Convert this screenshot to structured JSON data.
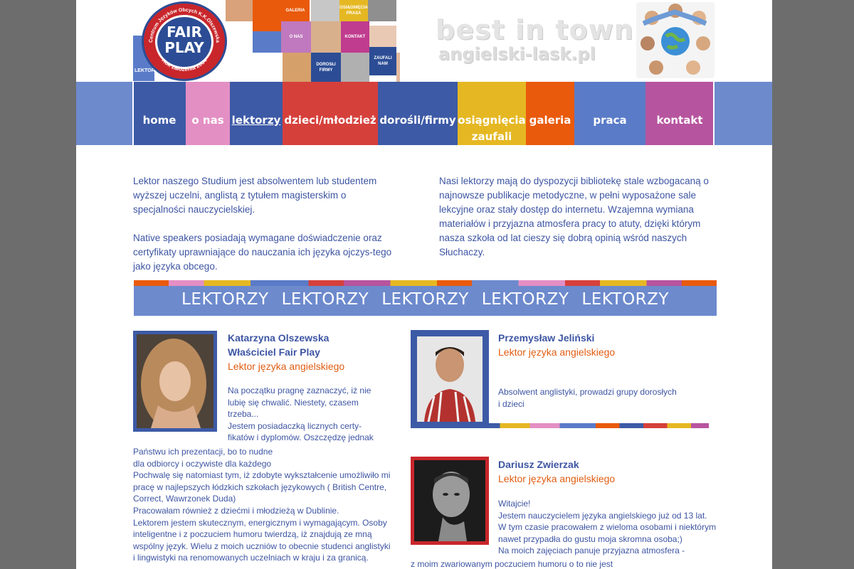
{
  "header": {
    "logo": {
      "line1": "FAIR",
      "line2": "PLAY",
      "arc_text": "Centrum Języków Obcych K.K.Olszewska",
      "founded": "Rok założenia 2004",
      "side_tag": "LEKTORZY"
    },
    "mosaic_tiles": [
      "GALERIA",
      "OSIĄGNIĘCIA PRASA",
      "O NAS",
      "KONTAKT",
      "DOROSŁI FIRMY",
      "ZAUFALI NAM"
    ],
    "tagline_main": "best in town",
    "tagline_domain": "angielski-lask.pl"
  },
  "nav": {
    "items": [
      {
        "label": "home"
      },
      {
        "label": "o nas"
      },
      {
        "label": "lektorzy"
      },
      {
        "label": "dzieci/młodzież"
      },
      {
        "label": "dorośli/firmy"
      },
      {
        "label": "osiągnięcia",
        "label2": "zaufali nam"
      },
      {
        "label": "galeria"
      },
      {
        "label": "praca"
      },
      {
        "label": "kontakt"
      }
    ]
  },
  "intro": {
    "left_p1": "Lektor naszego Studium jest absolwentem lub studentem wyższej uczelni, anglistą z tytułem magisterskim o specjalności nauczycielskiej.",
    "left_p2": "Native speakers posiadają wymagane doświadczenie oraz certyfikaty uprawniające do nauczania ich języka ojczys-tego jako języka obcego.",
    "right_p1": "Nasi lektorzy mają do dyspozycji bibliotekę stale wzbogacaną o najnowsze publikacje metodyczne, w pełni wyposażone sale lekcyjne oraz stały dostęp do internetu. Wzajemna wymiana materiałów i przyjazna atmosfera pracy to atuty, dzięki którym nasza szkoła od lat cieszy się dobrą opinią wśród naszych Słuchaczy."
  },
  "band": {
    "words": [
      "LEKTORZY",
      "LEKTORZY",
      "LEKTORZY",
      "LEKTORZY",
      "LEKTORZY"
    ]
  },
  "teachers": [
    {
      "name": "Katarzyna Olszewska",
      "title": "Właściciel Fair Play",
      "role": "Lektor języka angielskiego",
      "lines_narrow": [
        "Na początku pragnę zaznaczyć, iż nie",
        "lubię się chwalić. Niestety, czasem",
        "trzeba...",
        "Jestem posiadaczką licznych certy-",
        "fikatów i dyplomów. Oszczędzę jednak"
      ],
      "lines_wide": [
        "Państwu ich prezentacji, bo to nudne",
        "dla odbiorcy i oczywiste dla każdego",
        "Pochwalę się natomiast tym, iż zdobyte wykształcenie umożliwiło mi",
        "pracę w najlepszych łódzkich szkołach językowych ( British Centre,",
        "Correct, Wawrzonek Duda)",
        "Pracowałam również z dziećmi i młodzieżą w Dublinie.",
        "Lektorem jestem skutecznym, energicznym i wymagającym. Osoby",
        "inteligentne i z poczuciem humoru twierdzą, iż znajdują ze mną",
        "wspólny język. Wielu z moich uczniów to obecnie studenci anglistyki",
        "i lingwistyki na renomowanych uczelniach w kraju i za granicą."
      ]
    },
    {
      "name": "Przemysław Jeliński",
      "role": "Lektor języka angielskiego",
      "lines": [
        "Absolwent anglistyki, prowadzi grupy dorosłych",
        "i dzieci"
      ]
    },
    {
      "name": "Dariusz Zwierzak",
      "role": "Lektor języka angielskiego",
      "lines": [
        "Witajcie!",
        "Jestem nauczycielem języka angielskiego już od 13 lat.",
        "W tym czasie pracowałem z wieloma osobami i niektórym",
        "nawet przypadła do gustu moja skromna osoba;)",
        "Na moich zajęciach panuje przyjazna atmosfera -"
      ],
      "lines_wide": [
        "z moim zwariowanym poczuciem humoru o to nie jest"
      ]
    }
  ],
  "colors": {
    "page_bg": "#6d6d6d",
    "nav_blue": "#5a7bc8",
    "text_blue": "#3d55a3",
    "accent_orange": "#e05d12",
    "band_blue": "#6d8acd"
  }
}
